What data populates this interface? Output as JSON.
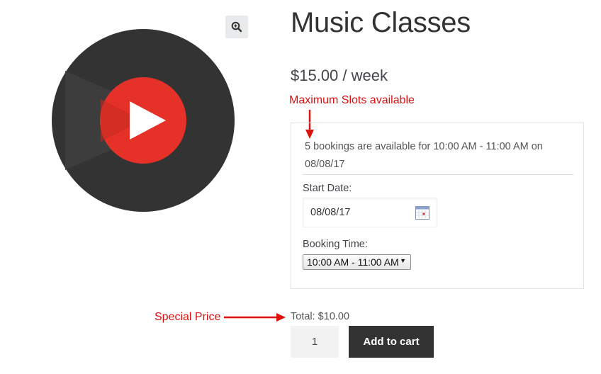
{
  "product": {
    "title": "Music Classes",
    "price": "$15.00 / week",
    "image_icon": "music-disc-play-icon",
    "zoom_icon": "zoom-in-icon"
  },
  "annotations": {
    "max_slots": "Maximum Slots available",
    "special_price": "Special Price"
  },
  "booking": {
    "availability_line1": "5 bookings are available for 10:00 AM - 11:00 AM on",
    "availability_line2": "08/08/17",
    "start_date_label": "Start Date:",
    "start_date_value": "08/08/17",
    "calendar_icon": "calendar-icon",
    "booking_time_label": "Booking Time:",
    "booking_time_value": "10:00 AM - 11:00 AM"
  },
  "cart": {
    "total": "Total: $10.00",
    "quantity": "1",
    "add_to_cart": "Add to cart"
  },
  "colors": {
    "accent_red": "#dd1010",
    "disc_dark": "#333333",
    "disc_center": "#e53127",
    "button_dark": "#333333"
  }
}
